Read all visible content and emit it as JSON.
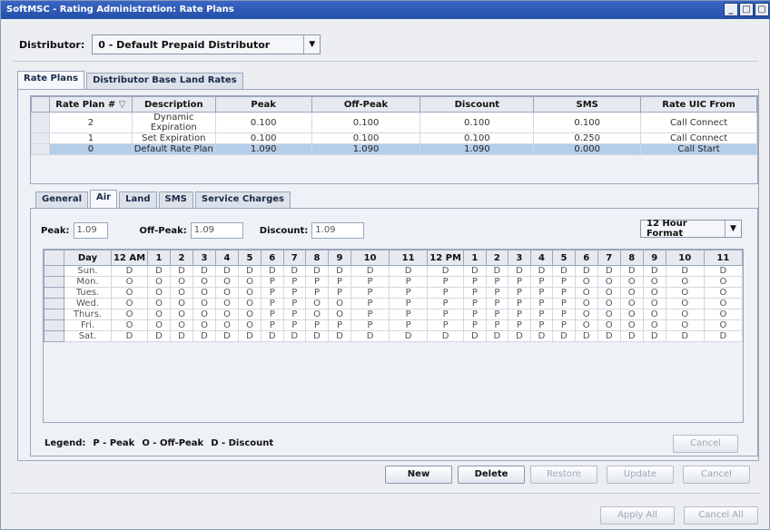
{
  "window": {
    "title": "SoftMSC - Rating Administration: Rate Plans",
    "buttons": [
      "_",
      "□",
      "▢"
    ]
  },
  "distributor": {
    "label": "Distributor:",
    "value": "0 - Default Prepaid Distributor"
  },
  "main_tabs": [
    "Rate Plans",
    "Distributor Base Land Rates"
  ],
  "rate_plans": {
    "columns": [
      "Rate Plan #",
      "Description",
      "Peak",
      "Off-Peak",
      "Discount",
      "SMS",
      "Rate UIC From"
    ],
    "rows": [
      [
        "2",
        "Dynamic Expiration",
        "0.100",
        "0.100",
        "0.100",
        "0.100",
        "Call Connect"
      ],
      [
        "1",
        "Set Expiration",
        "0.100",
        "0.100",
        "0.100",
        "0.250",
        "Call Connect"
      ],
      [
        "0",
        "Default Rate Plan",
        "1.090",
        "1.090",
        "1.090",
        "0.000",
        "Call Start"
      ]
    ],
    "selected_row": 2
  },
  "sub_tabs": [
    "General",
    "Air",
    "Land",
    "SMS",
    "Service Charges"
  ],
  "rates": {
    "peak_label": "Peak:",
    "peak": "1.09",
    "offpeak_label": "Off-Peak:",
    "offpeak": "1.09",
    "discount_label": "Discount:",
    "discount": "1.09",
    "format": "12 Hour Format"
  },
  "schedule": {
    "hours": [
      "12 AM",
      "1",
      "2",
      "3",
      "4",
      "5",
      "6",
      "7",
      "8",
      "9",
      "10",
      "11",
      "12 PM",
      "1",
      "2",
      "3",
      "4",
      "5",
      "6",
      "7",
      "8",
      "9",
      "10",
      "11"
    ],
    "day_header": "Day",
    "days": [
      {
        "day": "Sun.",
        "codes": "DDDDDDDDDDDDDDDDDDDDDDDD"
      },
      {
        "day": "Mon.",
        "codes": "OOOOOOPPPPPPPPPPPPOOOOOO"
      },
      {
        "day": "Tues.",
        "codes": "OOOOOOPPPPPPPPPPPPOOOOOO"
      },
      {
        "day": "Wed.",
        "codes": "OOOOOOPPOOPPPPPPPPOOOOOO"
      },
      {
        "day": "Thurs.",
        "codes": "OOOOOOPPOOPPPPPPPPOOOOOO"
      },
      {
        "day": "Fri.",
        "codes": "OOOOOOPPPPPPPPPPPPOOOOOO"
      },
      {
        "day": "Sat.",
        "codes": "DDDDDDDDDDDDDDDDDDDDDDDD"
      }
    ]
  },
  "legend": {
    "title": "Legend:",
    "peak": "P - Peak",
    "offpeak": "O - Off-Peak",
    "discount": "D - Discount"
  },
  "buttons": {
    "cancel_inner": "Cancel",
    "new": "New",
    "delete": "Delete",
    "restore": "Restore",
    "update": "Update",
    "cancel": "Cancel",
    "apply_all": "Apply All",
    "cancel_all": "Cancel All"
  }
}
